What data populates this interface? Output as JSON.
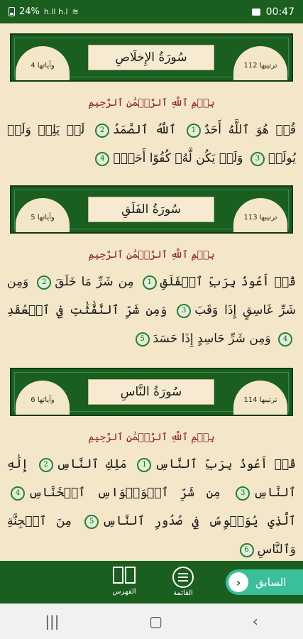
{
  "status_bar": {
    "battery": "24%",
    "network": "h.ll h.l",
    "wifi": "≋",
    "time": "00:47"
  },
  "suras": [
    {
      "rank_label": "ترتيبها 112",
      "ayat_label": "وآياتها 4",
      "name": "سُورَةُ الإِخلَاصِ",
      "basmala": "بِسۡمِ ٱللَّهِ ٱلرَّحۡمَٰنِ ٱلرَّحِيمِ",
      "verses": [
        {
          "text": "قُلۡ هُوَ ٱللَّهُ أَحَدٌ",
          "num": "1"
        },
        {
          "text": "ٱللَّهُ ٱلصَّمَدُ",
          "num": "2"
        },
        {
          "text": "لَمۡ يَلِدۡ وَلَمۡ يُولَدۡ",
          "num": "3"
        },
        {
          "text": "وَلَمۡ يَكُن لَّهُۥ كُفُوًا أَحَدُۢ",
          "num": "4"
        }
      ]
    },
    {
      "rank_label": "ترتيبها 113",
      "ayat_label": "وآياتها 5",
      "name": "سُورَةُ الفَلَقِ",
      "basmala": "بِسۡمِ ٱللَّهِ ٱلرَّحۡمَٰنِ ٱلرَّحِيمِ",
      "verses": [
        {
          "text": "قُلۡ أَعُوذُ بِرَبِّ ٱلۡفَلَقِ",
          "num": "1"
        },
        {
          "text": "مِن شَرِّ مَا خَلَقَ",
          "num": "2"
        },
        {
          "text": "وَمِن شَرِّ غَاسِقٍ إِذَا وَقَبَ",
          "num": "3"
        },
        {
          "text": "وَمِن شَرِّ ٱلنَّفَّٰثَٰتِ فِي ٱلۡعُقَدِ",
          "num": "4"
        },
        {
          "text": "وَمِن شَرِّ حَاسِدٍ إِذَا حَسَدَ",
          "num": "5"
        }
      ]
    },
    {
      "rank_label": "ترتيبها 114",
      "ayat_label": "وآياتها 6",
      "name": "سُورَةُ النَّاسِ",
      "basmala": "بِسۡمِ ٱللَّهِ ٱلرَّحۡمَٰنِ ٱلرَّحِيمِ",
      "verses": [
        {
          "text": "قُلۡ أَعُوذُ بِرَبِّ ٱلنَّاسِ",
          "num": "1"
        },
        {
          "text": "مَلِكِ ٱلنَّاسِ",
          "num": "2"
        },
        {
          "text": "إِلَٰهِ ٱلنَّاسِ",
          "num": "3"
        },
        {
          "text": "مِن شَرِّ ٱلۡوَسۡوَاسِ ٱلۡخَنَّاسِ",
          "num": "4"
        },
        {
          "text": "ٱلَّذِي يُوَسۡوِسُ فِي صُدُورِ ٱلنَّاسِ",
          "num": "5"
        },
        {
          "text": "مِنَ ٱلۡجِنَّةِ وَٱلنَّاسِ",
          "num": "6"
        }
      ]
    }
  ],
  "bottom_bar": {
    "prev_label": "السابق",
    "list_label": "القائمة",
    "index_label": "الفهرس"
  },
  "colors": {
    "green": "#1a5e20",
    "parchment": "#f4e6c8",
    "basmala": "#8b2420",
    "accent": "#3bbf9a"
  }
}
